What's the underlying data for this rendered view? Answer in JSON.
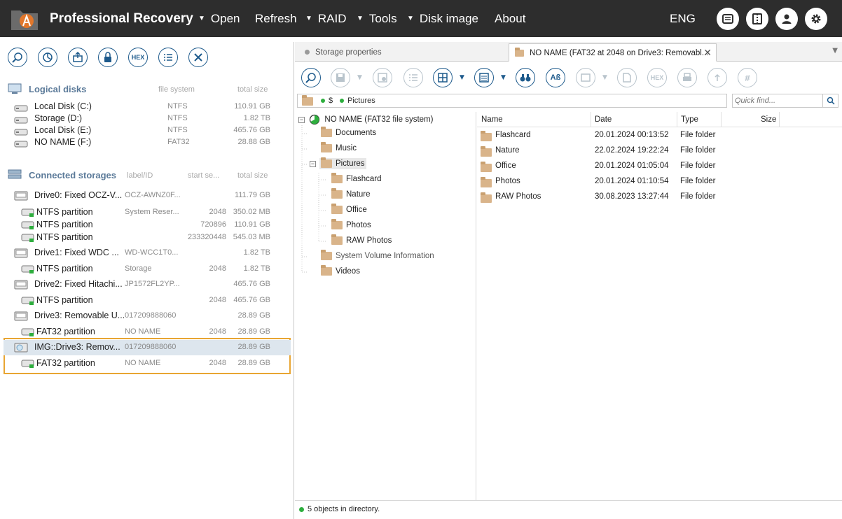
{
  "app": {
    "title": "Professional Recovery",
    "lang": "ENG"
  },
  "menu": [
    {
      "label": "Open",
      "arrow": true
    },
    {
      "label": "Refresh",
      "arrow": false
    },
    {
      "label": "RAID",
      "arrow": true
    },
    {
      "label": "Tools",
      "arrow": true
    },
    {
      "label": "Disk image",
      "arrow": true
    },
    {
      "label": "About",
      "arrow": false
    }
  ],
  "left": {
    "logical_title": "Logical disks",
    "logical_cols": [
      "file system",
      "total size"
    ],
    "logical": [
      {
        "name": "Local Disk (C:)",
        "fs": "NTFS",
        "size": "110.91 GB"
      },
      {
        "name": "Storage (D:)",
        "fs": "NTFS",
        "size": "1.82 TB"
      },
      {
        "name": "Local Disk (E:)",
        "fs": "NTFS",
        "size": "465.76 GB"
      },
      {
        "name": "NO NAME (F:)",
        "fs": "FAT32",
        "size": "28.88 GB"
      }
    ],
    "storages_title": "Connected storages",
    "storages_cols": [
      "label/ID",
      "start se...",
      "total size"
    ],
    "storages": [
      {
        "name": "Drive0: Fixed OCZ-V...",
        "label": "OCZ-AWNZ0F...",
        "start": "",
        "size": "111.79 GB",
        "type": "drive"
      },
      {
        "name": "NTFS partition",
        "label": "System Reser...",
        "start": "2048",
        "size": "350.02 MB",
        "type": "part"
      },
      {
        "name": "NTFS partition",
        "label": "",
        "start": "720896",
        "size": "110.91 GB",
        "type": "part"
      },
      {
        "name": "NTFS partition",
        "label": "",
        "start": "233320448",
        "size": "545.03 MB",
        "type": "part"
      },
      {
        "name": "Drive1: Fixed WDC ...",
        "label": "WD-WCC1T0...",
        "start": "",
        "size": "1.82 TB",
        "type": "drive"
      },
      {
        "name": "NTFS partition",
        "label": "Storage",
        "start": "2048",
        "size": "1.82 TB",
        "type": "part"
      },
      {
        "name": "Drive2: Fixed Hitachi...",
        "label": "JP1572FL2YP...",
        "start": "",
        "size": "465.76 GB",
        "type": "drive"
      },
      {
        "name": "NTFS partition",
        "label": "",
        "start": "2048",
        "size": "465.76 GB",
        "type": "part"
      },
      {
        "name": "Drive3: Removable U...",
        "label": "017209888060",
        "start": "",
        "size": "28.89 GB",
        "type": "drive"
      },
      {
        "name": "FAT32 partition",
        "label": "NO NAME",
        "start": "2048",
        "size": "28.89 GB",
        "type": "part"
      },
      {
        "name": "IMG::Drive3: Remov...",
        "label": "017209888060",
        "start": "",
        "size": "28.89 GB",
        "type": "img"
      },
      {
        "name": "FAT32 partition",
        "label": "NO NAME",
        "start": "2048",
        "size": "28.89 GB",
        "type": "part"
      }
    ]
  },
  "tabs": [
    {
      "label": "Storage properties"
    },
    {
      "label": "NO NAME (FAT32 at 2048 on Drive3: Removabl..."
    }
  ],
  "path": [
    "$",
    "Pictures"
  ],
  "find_placeholder": "Quick find...",
  "tree": {
    "root": "NO NAME (FAT32 file system)",
    "items": [
      {
        "label": "Documents",
        "level": 1,
        "expander": ""
      },
      {
        "label": "Music",
        "level": 1,
        "expander": ""
      },
      {
        "label": "Pictures",
        "level": 1,
        "expander": "minus"
      },
      {
        "label": "Flashcard",
        "level": 2,
        "expander": ""
      },
      {
        "label": "Nature",
        "level": 2,
        "expander": ""
      },
      {
        "label": "Office",
        "level": 2,
        "expander": ""
      },
      {
        "label": "Photos",
        "level": 2,
        "expander": ""
      },
      {
        "label": "RAW Photos",
        "level": 2,
        "expander": ""
      },
      {
        "label": "System Volume Information",
        "level": 1,
        "expander": ""
      },
      {
        "label": "Videos",
        "level": 1,
        "expander": ""
      }
    ]
  },
  "list": {
    "columns": [
      "Name",
      "Date",
      "Type",
      "Size"
    ],
    "rows": [
      {
        "name": "Flashcard",
        "date": "20.01.2024 00:13:52",
        "type": "File folder",
        "size": ""
      },
      {
        "name": "Nature",
        "date": "22.02.2024 19:22:24",
        "type": "File folder",
        "size": ""
      },
      {
        "name": "Office",
        "date": "20.01.2024 01:05:04",
        "type": "File folder",
        "size": ""
      },
      {
        "name": "Photos",
        "date": "20.01.2024 01:10:54",
        "type": "File folder",
        "size": ""
      },
      {
        "name": "RAW Photos",
        "date": "30.08.2023 13:27:44",
        "type": "File folder",
        "size": ""
      }
    ]
  },
  "status": "5 objects in directory.",
  "hex_label": "HEX",
  "colors": {
    "accent": "#1d5a8c",
    "topbar": "#2d2d2d",
    "highlight": "#e8a532",
    "status_dot": "#2eae3e"
  }
}
